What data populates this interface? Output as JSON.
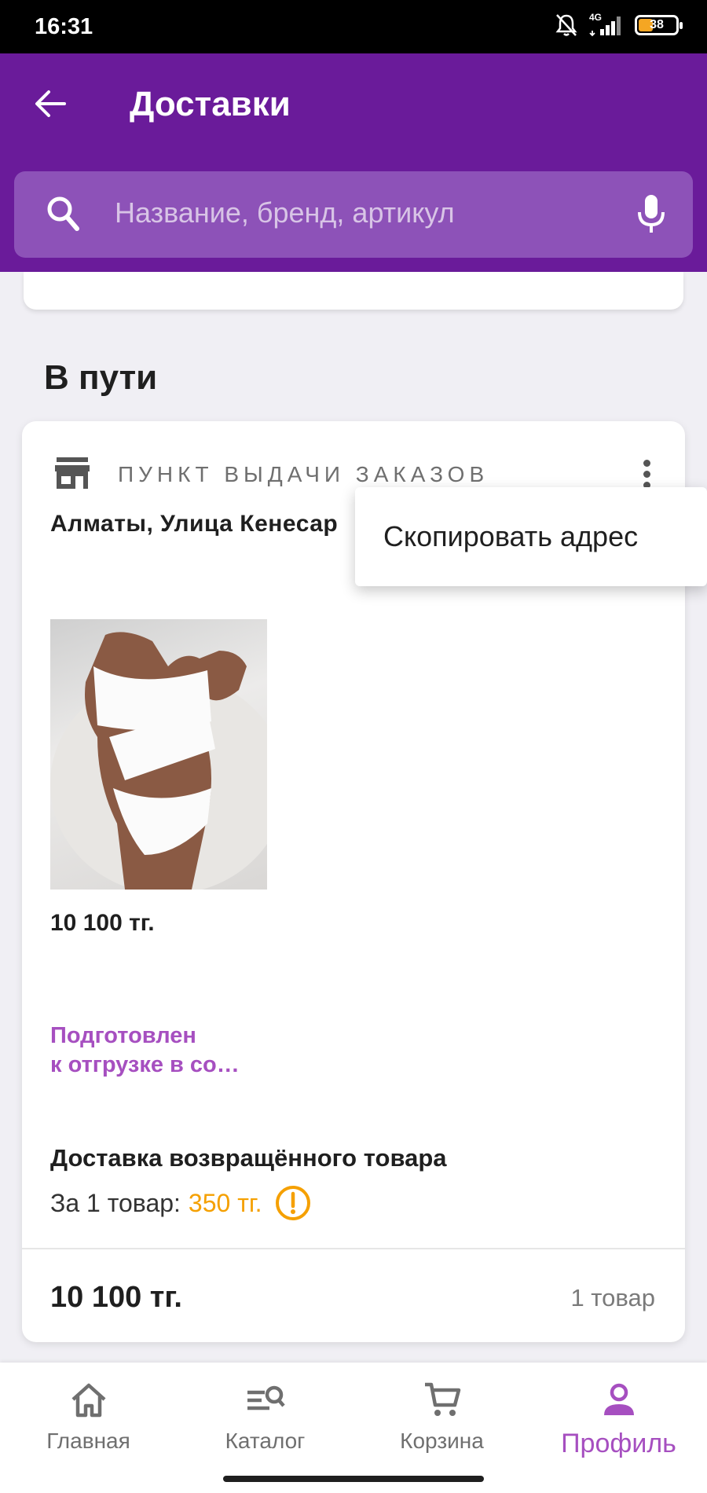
{
  "status_bar": {
    "time": "16:31",
    "network": "4G",
    "battery": "38",
    "battery_level": 0.38,
    "icons": [
      "bell-off-icon",
      "signal-icon",
      "battery-icon"
    ]
  },
  "header": {
    "title": "Доставки",
    "back_icon": "arrow-back-icon",
    "background": "#6a1b9a"
  },
  "search": {
    "placeholder": "Название, бренд, артикул",
    "icon": "search-icon",
    "mic_icon": "mic-icon"
  },
  "section": {
    "title": "В пути"
  },
  "order": {
    "pickup_label": "ПУНКТ ВЫДАЧИ ЗАКАЗОВ",
    "address": "Алматы, Улица Кенесар",
    "item_price": "10 100 тг.",
    "item_status_line1": "Подготовлен",
    "item_status_line2": "к отгрузке в со…",
    "return_title": "Доставка возвращённого товара",
    "return_price_label": "За 1 товар:",
    "return_price_value": "350 тг.",
    "total_price": "10 100 тг.",
    "total_count": "1 товар"
  },
  "context_menu": {
    "items": [
      {
        "label": "Скопировать адрес"
      }
    ]
  },
  "bottom_nav": {
    "items": [
      {
        "label": "Главная",
        "icon": "home-icon"
      },
      {
        "label": "Каталог",
        "icon": "catalog-search-icon"
      },
      {
        "label": "Корзина",
        "icon": "cart-icon"
      },
      {
        "label": "Профиль",
        "icon": "profile-icon",
        "active": true
      }
    ]
  },
  "colors": {
    "primary": "#6a1b9a",
    "accent": "#a64fc0",
    "warning": "#f5a000"
  }
}
